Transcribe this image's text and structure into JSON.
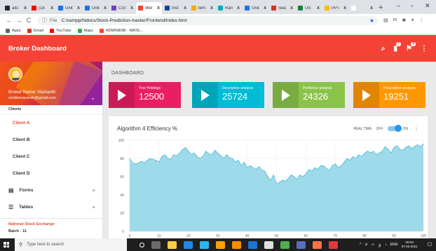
{
  "browser": {
    "tabs": [
      {
        "title": "ato:",
        "color": "#24292e"
      },
      {
        "title": "(18",
        "color": "#ff0000"
      },
      {
        "title": "Unit",
        "color": "#1a73e8"
      },
      {
        "title": "Unit",
        "color": "#1a73e8"
      },
      {
        "title": "CSI",
        "color": "#6f42c1"
      },
      {
        "title": "Wel",
        "color": "#f44336",
        "active": true
      },
      {
        "title": "Inst",
        "color": "#0d47a1"
      },
      {
        "title": "tem",
        "color": "#f9ab00"
      },
      {
        "title": "Ran",
        "color": "#00acc1"
      },
      {
        "title": "Unit",
        "color": "#1a73e8"
      },
      {
        "title": "Sea",
        "color": "#d93025"
      },
      {
        "title": "US",
        "color": "#188038"
      },
      {
        "title": "PPT",
        "color": "#fbbc04"
      },
      {
        "title": "",
        "color": "#ffffff"
      }
    ],
    "tab_close": "x",
    "new_tab": "+",
    "window_controls": {
      "minimize": "–",
      "maximize": "▫",
      "close": "✕"
    },
    "nav": {
      "back": "←",
      "forward": "→",
      "reload": "C"
    },
    "address": {
      "info_icon": "ⓘ",
      "scheme_label": "File",
      "url": "C:/xampp/htdocs/Stock-Prediction-master/Frontend/index.html",
      "star": "★"
    },
    "extensions": [
      "▤",
      "m",
      "✱",
      "◕",
      "⋮"
    ],
    "bookmarks": [
      {
        "label": "Apps",
        "color": "#5f6368"
      },
      {
        "label": "Gmail",
        "color": "#d93025"
      },
      {
        "label": "YouTube",
        "color": "#ff0000"
      },
      {
        "label": "Maps",
        "color": "#34a853"
      },
      {
        "label": "ADMINBSB - MATE...",
        "color": "#f44336"
      }
    ]
  },
  "app": {
    "title": "Broker Dashboard",
    "header_icons": {
      "search": "⌕",
      "notifications": "7",
      "tasks": "9",
      "more": "⋮"
    },
    "user": {
      "name": "Broker Name: Nishanth",
      "email": "rockbinvaransh@gmail.com",
      "chevron": "⌄"
    },
    "clients_label": "Clients",
    "clients": [
      "Client A",
      "Client B",
      "Client C",
      "Client D"
    ],
    "active_client": "Client A",
    "menu_groups": [
      {
        "label": "Forms",
        "icon": "▤",
        "expand": "+"
      },
      {
        "label": "Tables",
        "icon": "☰",
        "expand": "+"
      }
    ],
    "footer": {
      "title": "National Stock Exchange",
      "subtitle": "Batch - 11"
    },
    "breadcrumb": "DASHBOARD",
    "cards": [
      {
        "label": "Your Holdings",
        "value": "12500",
        "color": "#e91e63"
      },
      {
        "label": "Descriptive analysis",
        "value": "25724",
        "color": "#00bcd4"
      },
      {
        "label": "Predictive analysis",
        "value": "24326",
        "color": "#8bc34a"
      },
      {
        "label": "Prescriptive analysis",
        "value": "19251",
        "color": "#ff9800"
      }
    ],
    "chart_panel": {
      "title": "Algorithm 4 Efficiency %",
      "realtime_label": "REAL TIME",
      "off_label": "OFF",
      "on_label": "ON",
      "more_icon": "⋮"
    }
  },
  "chart_data": {
    "type": "area",
    "title": "Algorithm 4 Efficiency %",
    "xlim": [
      0,
      100
    ],
    "ylim": [
      0,
      100
    ],
    "x_ticks": [
      0,
      10,
      20,
      30,
      40,
      50,
      60,
      70,
      80,
      90,
      100
    ],
    "y_ticks": [
      0,
      20,
      40,
      60,
      80,
      100
    ],
    "fill_color": "#9fdaea",
    "line_color": "#5fc3db",
    "series": [
      {
        "x": [
          0,
          1,
          2,
          3,
          4,
          5,
          6,
          7,
          8,
          9,
          10,
          11,
          12,
          13,
          14,
          15,
          16,
          17,
          18,
          19,
          20,
          21,
          22,
          23,
          24,
          25,
          26,
          27,
          28,
          29,
          30,
          31,
          32,
          33,
          34,
          35,
          36,
          37,
          38,
          39,
          40,
          41,
          42,
          43,
          44,
          45,
          46,
          47,
          48,
          49,
          50,
          51,
          52,
          53,
          54,
          55,
          56,
          57,
          58,
          59,
          60,
          61,
          62,
          63,
          64,
          65,
          66,
          67,
          68,
          69,
          70,
          71,
          72,
          73,
          74,
          75,
          76,
          77,
          78,
          79,
          80,
          81,
          82,
          83,
          84,
          85,
          86,
          87,
          88,
          89,
          90,
          91,
          92,
          93,
          94,
          95,
          96,
          97,
          98,
          99,
          100
        ],
        "y": [
          80,
          75,
          74,
          75,
          77,
          75,
          78,
          80,
          79,
          78,
          76,
          82,
          84,
          80,
          79,
          84,
          83,
          86,
          90,
          92,
          88,
          84,
          86,
          82,
          80,
          83,
          88,
          85,
          84,
          89,
          86,
          83,
          80,
          84,
          81,
          80,
          76,
          78,
          72,
          76,
          70,
          72,
          70,
          68,
          71,
          67,
          66,
          60,
          56,
          62,
          52,
          54,
          56,
          55,
          58,
          62,
          60,
          57,
          62,
          60,
          63,
          68,
          66,
          70,
          68,
          72,
          72,
          69,
          67,
          72,
          74,
          70,
          72,
          76,
          80,
          78,
          82,
          80,
          84,
          82,
          86,
          88,
          86,
          88,
          84,
          86,
          88,
          93,
          90,
          86,
          92,
          94,
          90,
          89,
          92,
          94,
          91,
          93,
          95,
          93,
          96
        ]
      }
    ]
  },
  "taskbar": {
    "search_placeholder": "Type here to search",
    "search_icon": "⚲",
    "apps": [
      "#ffffff",
      "#6b6b6b",
      "#ffcc40",
      "#1e88e5",
      "#29b6f6",
      "#ffa000",
      "#fb8c00",
      "#1976d2",
      "#e0e0e0",
      "#4caf50",
      "#5c6bc0",
      "#ff7043",
      "#e53935"
    ],
    "tray": [
      "^",
      "⊙",
      "▭",
      "ℊ",
      "♪",
      "ENG"
    ],
    "time": "09:03",
    "date": "07-03-2021",
    "notification_icon": "☐"
  }
}
